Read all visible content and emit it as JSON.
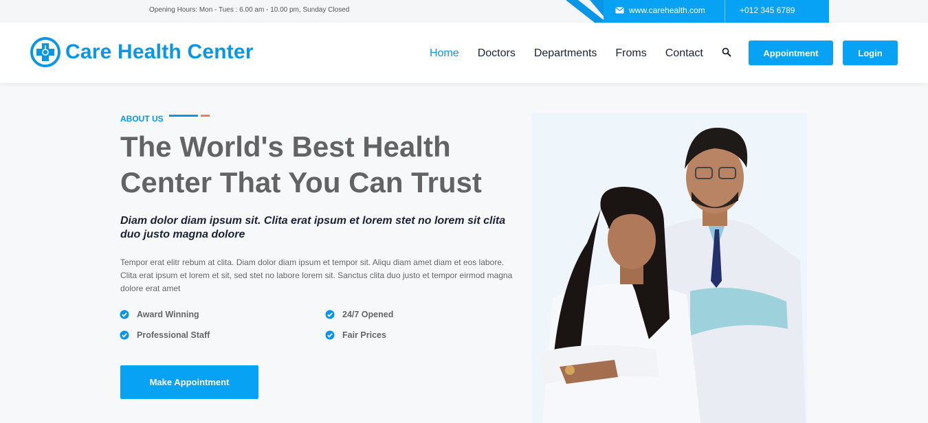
{
  "topbar": {
    "hours": "Opening Hours: Mon - Tues : 6.00 am - 10.00 pm, Sunday Closed",
    "email": "www.carehealth.com",
    "phone": "+012 345 6789"
  },
  "brand": {
    "name": "Care Health Center",
    "accent_color": "#0a96e6"
  },
  "nav": {
    "items": [
      "Home",
      "Doctors",
      "Departments",
      "Froms",
      "Contact"
    ],
    "active": "Home"
  },
  "header_buttons": {
    "appointment": "Appointment",
    "login": "Login"
  },
  "about": {
    "label": "ABOUT US",
    "headline_line1": "The World's Best Health",
    "headline_line2": "Center That You Can Trust",
    "subhead": "Diam dolor diam ipsum sit. Clita erat ipsum et lorem stet no lorem sit clita duo justo magna dolore",
    "paragraph": "Tempor erat elitr rebum at clita. Diam dolor diam ipsum et tempor sit. Aliqu diam amet diam et eos labore. Clita erat ipsum et lorem et sit, sed stet no labore lorem sit. Sanctus clita duo justo et tempor eirmod magna dolore erat amet",
    "features": [
      "Award Winning",
      "24/7 Opened",
      "Professional Staff",
      "Fair Prices"
    ],
    "cta": "Make Appointment"
  },
  "icons": {
    "email": "envelope-icon",
    "search": "search-icon",
    "check": "check-circle-icon",
    "logo": "medical-cross-icon"
  }
}
